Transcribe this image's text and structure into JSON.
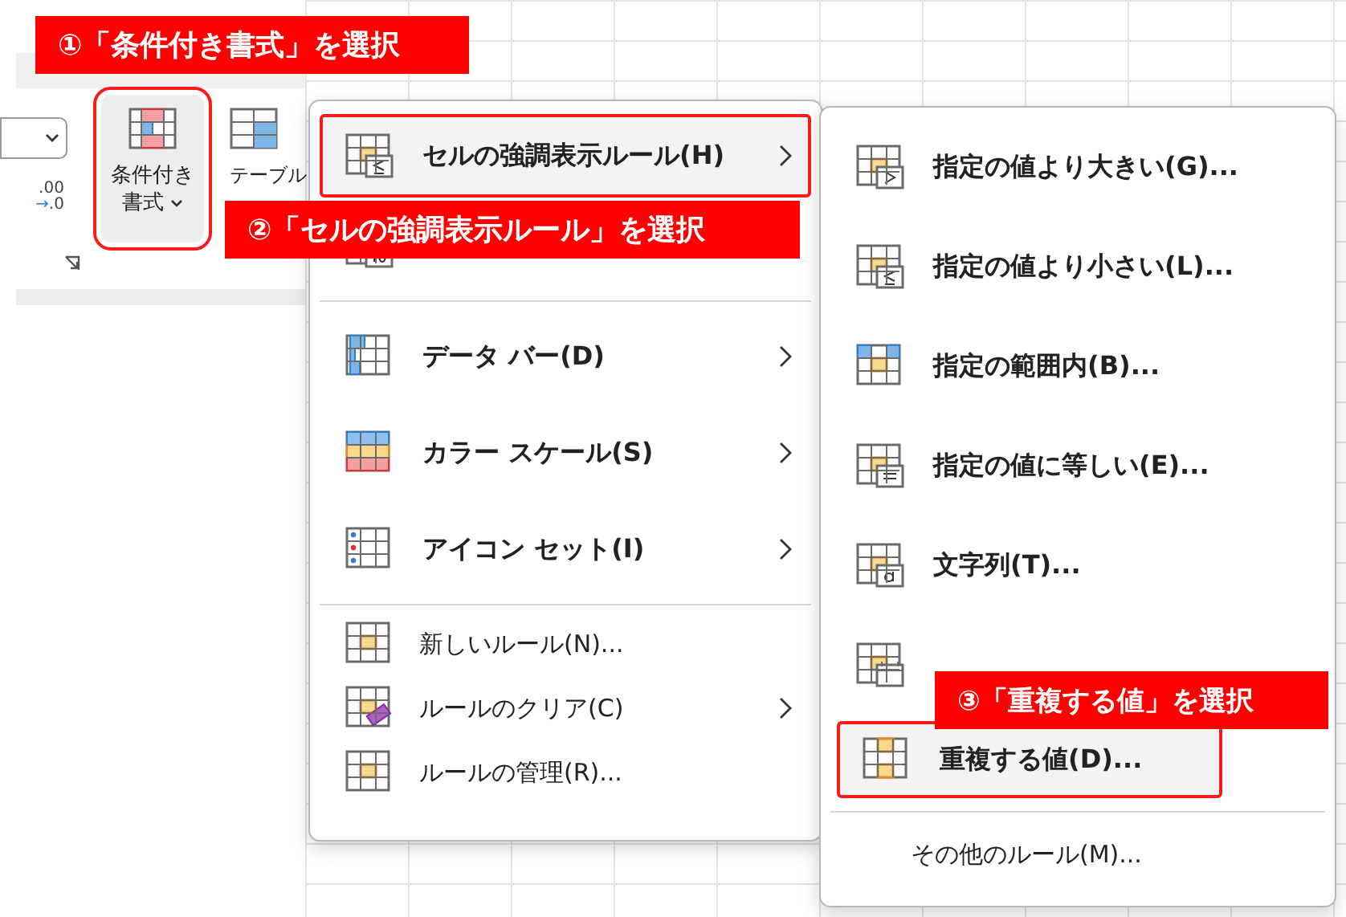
{
  "callouts": [
    {
      "text": "①「条件付き書式」を選択"
    },
    {
      "text": "②「セルの強調表示ルール」を選択"
    },
    {
      "text": "③「重複する値」を選択"
    }
  ],
  "ribbon": {
    "decimal_button": {
      "top": ".00",
      "arrow": "→",
      "bottom": ".0"
    },
    "conditional_formatting": {
      "label_lines": [
        "条件付き",
        "書式"
      ],
      "selected": true
    },
    "table_button": {
      "label": "テーブル"
    }
  },
  "menu": {
    "items": [
      {
        "kind": "large",
        "label": "セルの強調表示ルール(H)",
        "selected": true,
        "has_submenu": true
      },
      {
        "kind": "large",
        "selected": false
      },
      {
        "kind": "separator"
      },
      {
        "kind": "large",
        "label": "データ バー(D)",
        "selected": false,
        "has_submenu": true
      },
      {
        "kind": "large",
        "label": "カラー スケール(S)",
        "selected": false,
        "has_submenu": true
      },
      {
        "kind": "large",
        "label": "アイコン セット(I)",
        "selected": false,
        "has_submenu": true
      },
      {
        "kind": "separator"
      },
      {
        "kind": "small",
        "label": "新しいルール(N)...",
        "selected": false,
        "has_submenu": false
      },
      {
        "kind": "small",
        "label": "ルールのクリア(C)",
        "selected": false,
        "has_submenu": true
      },
      {
        "kind": "small",
        "label": "ルールの管理(R)...",
        "selected": false,
        "has_submenu": false
      }
    ]
  },
  "submenu": {
    "items": [
      {
        "kind": "large",
        "label": "指定の値より大きい(G)...",
        "selected": false
      },
      {
        "kind": "large",
        "label": "指定の値より小さい(L)...",
        "selected": false
      },
      {
        "kind": "large",
        "label": "指定の範囲内(B)...",
        "selected": false
      },
      {
        "kind": "large",
        "label": "指定の値に等しい(E)...",
        "selected": false
      },
      {
        "kind": "large",
        "label": "文字列(T)...",
        "selected": false
      },
      {
        "kind": "large",
        "selected": false
      },
      {
        "kind": "large",
        "label": "重複する値(D)...",
        "selected": true
      },
      {
        "kind": "separator"
      },
      {
        "kind": "plain",
        "label": "その他のルール(M)...",
        "selected": false
      }
    ]
  }
}
